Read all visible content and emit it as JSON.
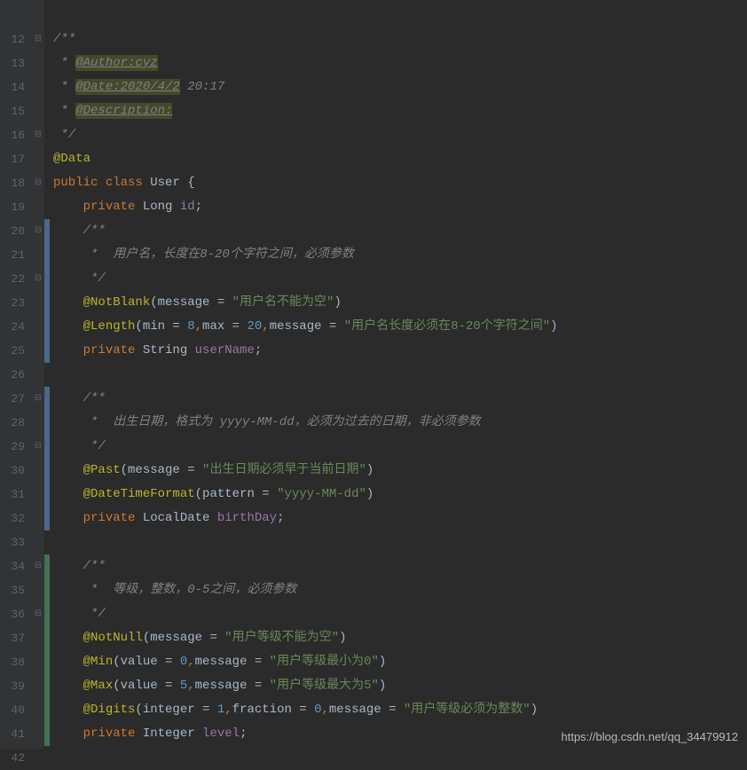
{
  "gutter": [
    "",
    "12",
    "13",
    "14",
    "15",
    "16",
    "17",
    "18",
    "19",
    "20",
    "21",
    "22",
    "23",
    "24",
    "25",
    "26",
    "27",
    "28",
    "29",
    "30",
    "31",
    "32",
    "33",
    "34",
    "35",
    "36",
    "37",
    "38",
    "39",
    "40",
    "41",
    "42"
  ],
  "fold": [
    "",
    "⊟",
    "",
    "",
    "",
    "⊟",
    "",
    "⊟",
    "",
    "⊟",
    "",
    "⊟",
    "",
    "",
    "",
    "",
    "⊟",
    "",
    "⊟",
    "",
    "",
    "",
    "",
    "⊟",
    "",
    "⊟",
    "",
    "",
    "",
    "",
    "",
    ""
  ],
  "change": [
    "",
    "",
    "",
    "",
    "",
    "",
    "",
    "",
    "",
    "b",
    "b",
    "b",
    "b",
    "b",
    "b",
    "",
    "b",
    "b",
    "b",
    "b",
    "b",
    "b",
    "",
    "g",
    "g",
    "g",
    "g",
    "g",
    "g",
    "g",
    "g",
    ""
  ],
  "code": {
    "l0": "",
    "l1_a": "/**",
    "l2_a": " * ",
    "l2_b": "@Author:cyz",
    "l3_a": " * ",
    "l3_b": "@Date:2020/4/2",
    "l3_c": " 20:17",
    "l4_a": " * ",
    "l4_b": "@Description:",
    "l5_a": " */",
    "l6_ann": "@Data",
    "l7_kw1": "public ",
    "l7_kw2": "class ",
    "l7_name": "User {",
    "l8_kw": "private ",
    "l8_type": "Long ",
    "l8_field": "id",
    "l8_end": ";",
    "l9_a": "/**",
    "l10_a": " *  用户名，长度在8-20个字符之间，必须参数",
    "l11_a": " */",
    "l12_ann": "@NotBlank",
    "l12_p": "(message = ",
    "l12_s": "\"用户名不能为空\"",
    "l12_e": ")",
    "l13_ann": "@Length",
    "l13_p1": "(min = ",
    "l13_n1": "8",
    "l13_c1": ",",
    "l13_p2": "max = ",
    "l13_n2": "20",
    "l13_c2": ",",
    "l13_p3": "message = ",
    "l13_s": "\"用户名长度必须在8-20个字符之间\"",
    "l13_e": ")",
    "l14_kw": "private ",
    "l14_type": "String ",
    "l14_field": "userName",
    "l14_end": ";",
    "l15_a": "",
    "l16_a": "/**",
    "l17_a": " *  出生日期，格式为 yyyy-MM-dd，必须为过去的日期，非必须参数",
    "l18_a": " */",
    "l19_ann": "@Past",
    "l19_p": "(message = ",
    "l19_s": "\"出生日期必须早于当前日期\"",
    "l19_e": ")",
    "l20_ann": "@DateTimeFormat",
    "l20_p": "(pattern = ",
    "l20_s": "\"yyyy-MM-dd\"",
    "l20_e": ")",
    "l21_kw": "private ",
    "l21_type": "LocalDate ",
    "l21_field": "birthDay",
    "l21_end": ";",
    "l22_a": "",
    "l23_a": "/**",
    "l24_a": " *  等级，整数，0-5之间，必须参数",
    "l25_a": " */",
    "l26_ann": "@NotNull",
    "l26_p": "(message = ",
    "l26_s": "\"用户等级不能为空\"",
    "l26_e": ")",
    "l27_ann": "@Min",
    "l27_p1": "(value = ",
    "l27_n": "0",
    "l27_c": ",",
    "l27_p2": "message = ",
    "l27_s": "\"用户等级最小为0\"",
    "l27_e": ")",
    "l28_ann": "@Max",
    "l28_p1": "(value = ",
    "l28_n": "5",
    "l28_c": ",",
    "l28_p2": "message = ",
    "l28_s": "\"用户等级最大为5\"",
    "l28_e": ")",
    "l29_ann": "@Digits",
    "l29_p1": "(integer = ",
    "l29_n1": "1",
    "l29_c1": ",",
    "l29_p2": "fraction = ",
    "l29_n2": "0",
    "l29_c2": ",",
    "l29_p3": "message = ",
    "l29_s": "\"用户等级必须为整数\"",
    "l29_e": ")",
    "l30_kw": "private ",
    "l30_type": "Integer ",
    "l30_field": "level",
    "l30_end": ";",
    "l31_a": ""
  },
  "watermark": "https://blog.csdn.net/qq_34479912"
}
